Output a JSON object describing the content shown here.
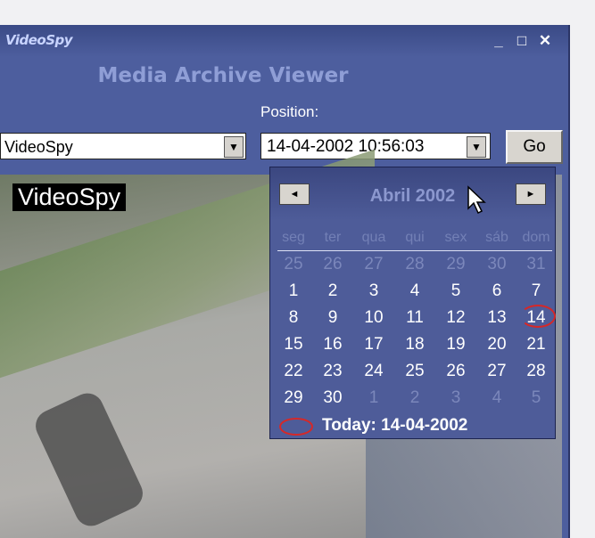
{
  "window": {
    "logo_text": "VideoSpy",
    "title": "Media Archive Viewer",
    "minimize_label": "_",
    "maximize_label": "□",
    "close_label": "✕"
  },
  "controls": {
    "position_label": "Position:",
    "camera_value": "VideoSpy",
    "datetime_value": "14-04-2002  10:56:03",
    "dropdown_arrow": "▼",
    "go_label": "Go"
  },
  "video": {
    "caption": "VideoSpy"
  },
  "calendar": {
    "month_label": "Abril 2002",
    "prev_label": "◄",
    "next_label": "►",
    "weekdays": [
      "seg",
      "ter",
      "qua",
      "qui",
      "sex",
      "sáb",
      "dom"
    ],
    "weeks": [
      [
        "25",
        "26",
        "27",
        "28",
        "29",
        "30",
        "31"
      ],
      [
        "1",
        "2",
        "3",
        "4",
        "5",
        "6",
        "7"
      ],
      [
        "8",
        "9",
        "10",
        "11",
        "12",
        "13",
        "14"
      ],
      [
        "15",
        "16",
        "17",
        "18",
        "19",
        "20",
        "21"
      ],
      [
        "22",
        "23",
        "24",
        "25",
        "26",
        "27",
        "28"
      ],
      [
        "29",
        "30",
        "1",
        "2",
        "3",
        "4",
        "5"
      ]
    ],
    "today_label": "Today: 14-04-2002",
    "accent_color": "#d62828"
  }
}
